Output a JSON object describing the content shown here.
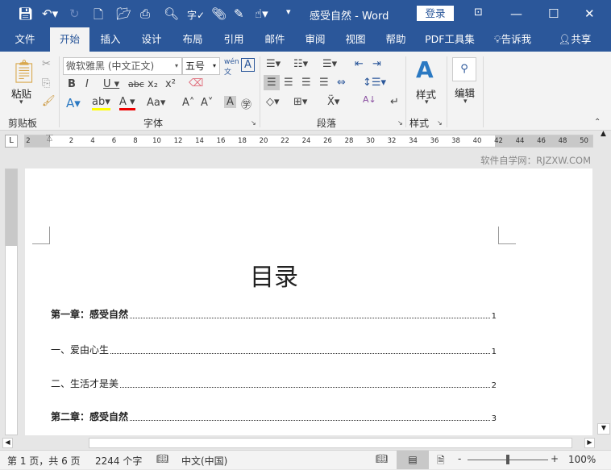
{
  "titlebar": {
    "doc_title": "感受自然 - Word",
    "login": "登录"
  },
  "tabs": [
    "文件",
    "开始",
    "插入",
    "设计",
    "布局",
    "引用",
    "邮件",
    "审阅",
    "视图",
    "帮助",
    "PDF工具集"
  ],
  "tell_me": "告诉我",
  "share": "共享",
  "ribbon": {
    "paste": "粘贴",
    "clipboard": "剪贴板",
    "font_name": "微软雅黑 (中文正文)",
    "font_size": "五号",
    "font_group": "字体",
    "paragraph_group": "段落",
    "styles": "样式",
    "styles_group": "样式",
    "editing": "编辑"
  },
  "ruler": {
    "labels": [
      "2",
      "2",
      "4",
      "6",
      "8",
      "10",
      "12",
      "14",
      "16",
      "18",
      "20",
      "22",
      "24",
      "26",
      "28",
      "30",
      "32",
      "34",
      "36",
      "38",
      "40",
      "42",
      "44",
      "46",
      "48",
      "50"
    ]
  },
  "watermark": "软件自学网：RJZXW.COM",
  "document": {
    "title": "目录",
    "toc": [
      {
        "text": "第一章：感受自然",
        "page": "1",
        "bold": true
      },
      {
        "text": "一、爱由心生",
        "page": "1",
        "bold": false
      },
      {
        "text": "二、生活才是美",
        "page": "2",
        "bold": false
      },
      {
        "text": "第二章：感受自然",
        "page": "3",
        "bold": true
      }
    ]
  },
  "status": {
    "page": "第 1 页，共 6 页",
    "words": "2244 个字",
    "language": "中文(中国)",
    "zoom": "100%",
    "zoom_percent": 100
  },
  "colors": {
    "accent": "#2b579a"
  }
}
